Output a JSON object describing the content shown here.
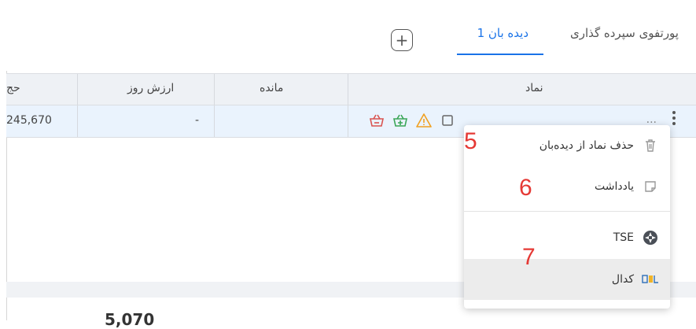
{
  "tabs": [
    {
      "label": "پورتفوی سپرده گذاری"
    },
    {
      "label": "دیده بان 1"
    }
  ],
  "add_button": "+",
  "table": {
    "headers": [
      "نماد",
      "مانده",
      "ارزش روز",
      "حج"
    ],
    "row": {
      "symbol": "...",
      "remaining": "",
      "day_value": "-",
      "volume": "245,670"
    }
  },
  "menu": {
    "items": [
      {
        "label": "حذف نماد از دیده‌بان",
        "icon": "trash-icon"
      },
      {
        "label": "یادداشت",
        "icon": "note-icon"
      },
      {
        "label": "TSE",
        "icon": "tse-logo-icon"
      },
      {
        "label": "کدال",
        "icon": "codal-logo-icon"
      }
    ]
  },
  "annotations": [
    "5",
    "6",
    "7"
  ],
  "bottom": {
    "value": "5,070"
  },
  "colors": {
    "accent": "#1a73e8",
    "step": "#e53935",
    "sell": "#d9534f",
    "buy": "#3aa657",
    "warn": "#f0a020"
  }
}
